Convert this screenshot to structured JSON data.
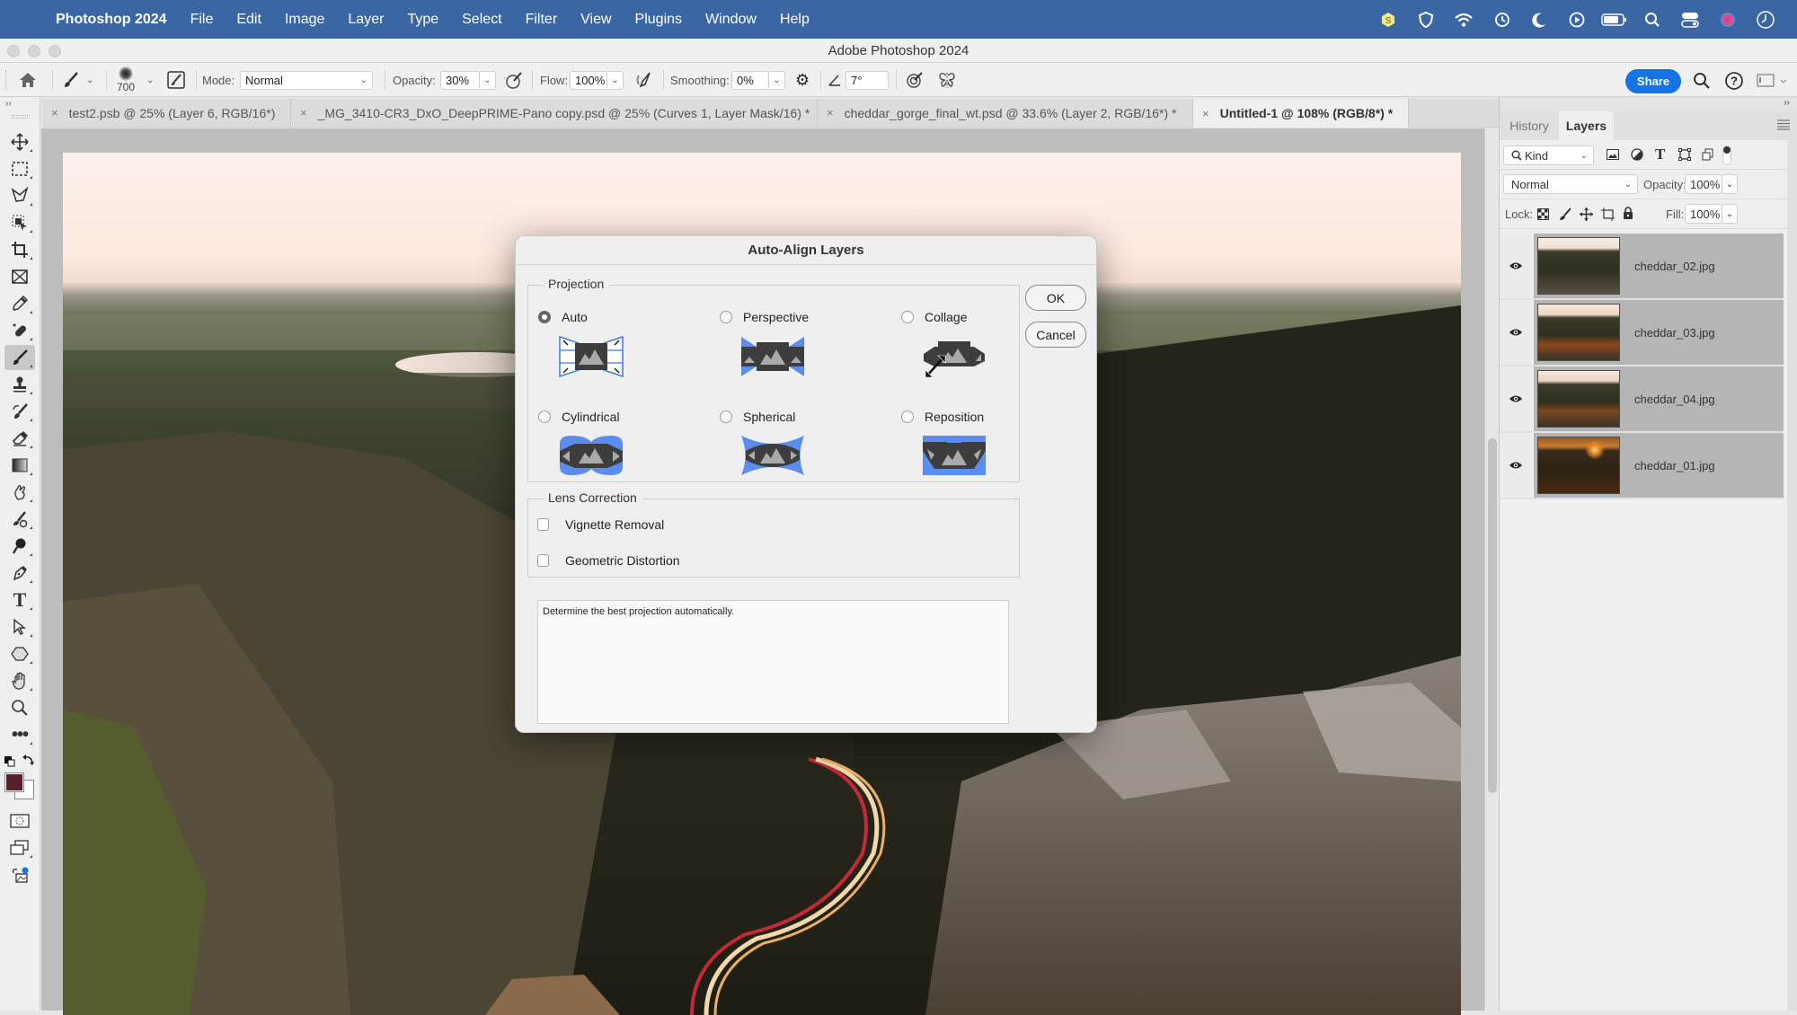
{
  "menubar": {
    "app_name": "Photoshop 2024",
    "items": [
      "File",
      "Edit",
      "Image",
      "Layer",
      "Type",
      "Select",
      "Filter",
      "View",
      "Plugins",
      "Window",
      "Help"
    ],
    "status_icons": [
      "s-app-icon",
      "shield-icon",
      "wifi-icon",
      "time-machine-icon",
      "moon-icon",
      "play-icon",
      "battery-icon",
      "spotlight-search-icon",
      "control-center-icon",
      "siri-icon",
      "clock-icon"
    ]
  },
  "window": {
    "title": "Adobe Photoshop 2024"
  },
  "options_bar": {
    "brush_size": "700",
    "mode_label": "Mode:",
    "mode_value": "Normal",
    "opacity_label": "Opacity:",
    "opacity_value": "30%",
    "flow_label": "Flow:",
    "flow_value": "100%",
    "smoothing_label": "Smoothing:",
    "smoothing_value": "0%",
    "angle_value": "7°",
    "share_label": "Share"
  },
  "tabs": [
    {
      "label": "test2.psb @ 25% (Layer 6, RGB/16*)",
      "active": false
    },
    {
      "label": "_MG_3410-CR3_DxO_DeepPRIME-Pano copy.psd @ 25% (Curves 1, Layer Mask/16) *",
      "active": false
    },
    {
      "label": "cheddar_gorge_final_wt.psd @ 33.6% (Layer 2, RGB/16*) *",
      "active": false
    },
    {
      "label": "Untitled-1 @ 108% (RGB/8*) *",
      "active": true
    }
  ],
  "tools": [
    "move",
    "rectangular-marquee",
    "lasso",
    "object-selection",
    "crop",
    "frame",
    "eyedropper",
    "spot-healing-brush",
    "brush",
    "clone-stamp",
    "history-brush",
    "eraser",
    "gradient",
    "smudge",
    "blur",
    "dodge",
    "pen",
    "type",
    "path-selection",
    "shape",
    "hand",
    "zoom",
    "edit-toolbar"
  ],
  "colors": {
    "foreground": "#5a1f2e",
    "background": "#ffffff",
    "accent": "#1473e6",
    "menubar": "#3a67a3"
  },
  "panel": {
    "tabs": [
      "History",
      "Layers"
    ],
    "active_tab": "Layers",
    "filter_kind": "Kind",
    "blend_mode": "Normal",
    "opacity_label": "Opacity:",
    "opacity_value": "100%",
    "lock_label": "Lock:",
    "fill_label": "Fill:",
    "fill_value": "100%",
    "layers": [
      {
        "name": "cheddar_02.jpg",
        "visible": true
      },
      {
        "name": "cheddar_03.jpg",
        "visible": true
      },
      {
        "name": "cheddar_04.jpg",
        "visible": true
      },
      {
        "name": "cheddar_01.jpg",
        "visible": true
      }
    ]
  },
  "dialog": {
    "title": "Auto-Align Layers",
    "projection_label": "Projection",
    "options": [
      {
        "label": "Auto",
        "selected": true
      },
      {
        "label": "Perspective",
        "selected": false
      },
      {
        "label": "Collage",
        "selected": false
      },
      {
        "label": "Cylindrical",
        "selected": false
      },
      {
        "label": "Spherical",
        "selected": false
      },
      {
        "label": "Reposition",
        "selected": false
      }
    ],
    "lens_label": "Lens Correction",
    "vignette_label": "Vignette Removal",
    "vignette_checked": false,
    "geometric_label": "Geometric Distortion",
    "geometric_checked": false,
    "description": "Determine the best projection automatically.",
    "ok_label": "OK",
    "cancel_label": "Cancel"
  }
}
